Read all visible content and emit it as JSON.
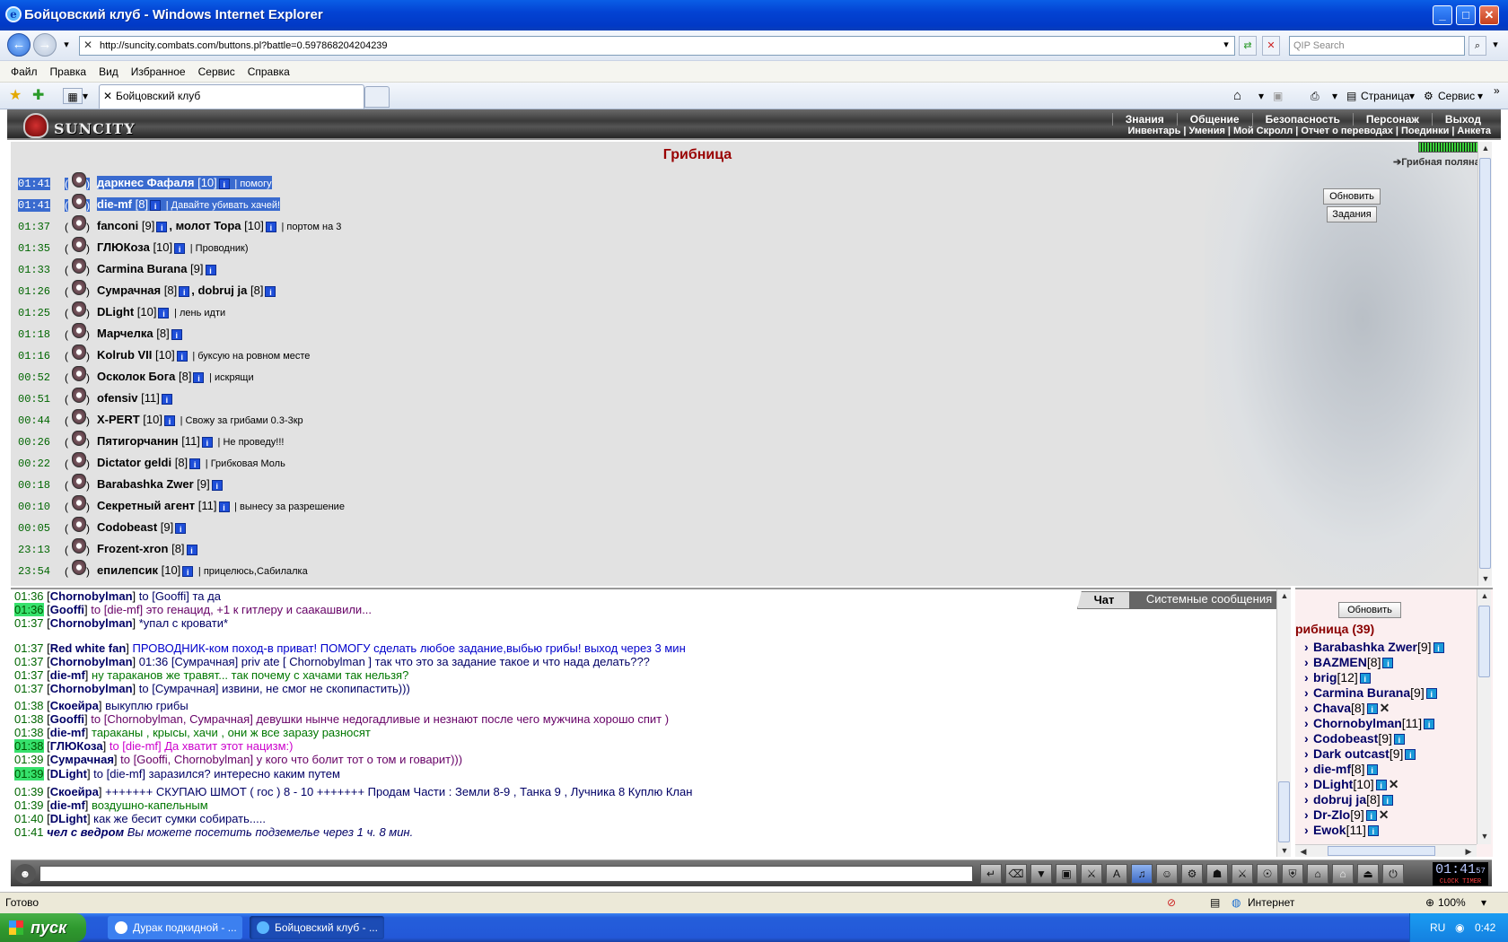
{
  "window": {
    "title": "Бойцовский клуб - Windows Internet Explorer"
  },
  "address": {
    "url": "http://suncity.combats.com/buttons.pl?battle=0.597868204204239",
    "search_placeholder": "QIP Search"
  },
  "menu": [
    "Файл",
    "Правка",
    "Вид",
    "Избранное",
    "Сервис",
    "Справка"
  ],
  "tab": {
    "title": "Бойцовский клуб"
  },
  "toolbar": {
    "page_label": "Страница",
    "service_label": "Сервис"
  },
  "game": {
    "logo": "SUNCITY",
    "top_menu": [
      "Знания",
      "Общение",
      "Безопасность",
      "Персонаж",
      "Выход"
    ],
    "sub_menu": [
      "Инвентарь",
      "Умения",
      "Мой Скролл",
      "Отчет о переводах",
      "Поединки",
      "Анкета"
    ],
    "room_title": "Грибница",
    "location_link": "Грибная поляна",
    "refresh_label": "Обновить",
    "tasks_label": "Задания",
    "players": [
      {
        "time": "01:41",
        "name": "даркнес Фафаля",
        "level": "[10]",
        "comment": "помогу",
        "selected": true
      },
      {
        "time": "01:41",
        "name": "die-mf",
        "level": "[8]",
        "comment": "Давайте убивать хачей!",
        "selected": true
      },
      {
        "time": "01:37",
        "name": "fanconi",
        "level": "[9]",
        "name2": "молот Тора",
        "level2": "[10]",
        "comment": "портом на 3"
      },
      {
        "time": "01:35",
        "name": "ГЛЮКоза",
        "level": "[10]",
        "comment": "Проводник)"
      },
      {
        "time": "01:33",
        "name": "Carmina Burana",
        "level": "[9]",
        "comment": ""
      },
      {
        "time": "01:26",
        "name": "Сумрачная",
        "level": "[8]",
        "name2": "dobruj ja",
        "level2": "[8]",
        "comment": ""
      },
      {
        "time": "01:25",
        "name": "DLight",
        "level": "[10]",
        "comment": "лень идти"
      },
      {
        "time": "01:18",
        "name": "Марчелка",
        "level": "[8]",
        "comment": ""
      },
      {
        "time": "01:16",
        "name": "Kolrub VII",
        "level": "[10]",
        "comment": "буксую на ровном месте"
      },
      {
        "time": "00:52",
        "name": "Осколок Бога",
        "level": "[8]",
        "comment": "искрящи"
      },
      {
        "time": "00:51",
        "name": "ofensiv",
        "level": "[11]",
        "comment": ""
      },
      {
        "time": "00:44",
        "name": "X-PERT",
        "level": "[10]",
        "comment": "Свожу за грибами 0.3-3кр"
      },
      {
        "time": "00:26",
        "name": "Пятигорчанин",
        "level": "[11]",
        "comment": "Не проведу!!!"
      },
      {
        "time": "00:22",
        "name": "Dictator geldi",
        "level": "[8]",
        "comment": "Грибковая Моль"
      },
      {
        "time": "00:18",
        "name": "Barabashka Zwer",
        "level": "[9]",
        "comment": ""
      },
      {
        "time": "00:10",
        "name": "Секретный агент",
        "level": "[11]",
        "comment": "вынесу за разрешение"
      },
      {
        "time": "00:05",
        "name": "Codobeast",
        "level": "[9]",
        "comment": ""
      },
      {
        "time": "23:13",
        "name": "Frozent-xron",
        "level": "[8]",
        "comment": ""
      },
      {
        "time": "23:54",
        "name": "епилепсик",
        "level": "[10]",
        "comment": "прицелюсь,Сабилалка"
      }
    ]
  },
  "chat": {
    "tab_chat": "Чат",
    "tab_system": "Системные сообщения",
    "lines": [
      {
        "time": "01:36",
        "nick": "Chornobylman",
        "text": " to [Gooffi] та да",
        "cls": "c-navy"
      },
      {
        "time": "01:36",
        "hl": true,
        "nick": "Gooffi",
        "text": " to [die-mf] это генацид, +1 к гитлеру и саакашвили...",
        "cls": "c-purple"
      },
      {
        "time": "01:37",
        "nick": "Chornobylman",
        "text": " *упал с кровати*",
        "cls": "c-navy"
      },
      {
        "time": "01:37",
        "nick": "Red white fan",
        "text": " ПРОВОДНИК-ком поход-в приват! ПОМОГУ сделать любое задание,выбью грибы!              выход через 3 мин",
        "cls": "c-blue"
      },
      {
        "time": "01:37",
        "nick": "Chornobylman",
        "text": " 01:36 [Сумрачная] priv ate [ Chornobylman ] так что это за задание такое и что нада делать???",
        "cls": "c-navy"
      },
      {
        "time": "01:37",
        "nick": "die-mf",
        "text": " ну тараканов же травят... так почему с хачами так нельзя?",
        "cls": "c-green"
      },
      {
        "time": "01:37",
        "nick": "Chornobylman",
        "text": " to [Сумрачная] извини, не смог не скопипастить)))",
        "cls": "c-navy"
      },
      {
        "time": "01:38",
        "nick": "Скоейра",
        "text": " выкуплю грибы",
        "cls": "c-navy"
      },
      {
        "time": "01:38",
        "nick": "Gooffi",
        "text": " to [Chornobylman, Сумрачная] девушки нынче недогадливые и незнают после чего мужчина хорошо спит )",
        "cls": "c-purple"
      },
      {
        "time": "01:38",
        "nick": "die-mf",
        "text": " тараканы , крысы, хачи , они ж все заразу разносят",
        "cls": "c-green"
      },
      {
        "time": "01:38",
        "hl": true,
        "nick": "ГЛЮКоза",
        "text": " to [die-mf] Да хватит этот нацизм:)",
        "cls": "c-magenta"
      },
      {
        "time": "01:39",
        "nick": "Сумрачная",
        "text": " to [Gooffi, Chornobylman] у кого что болит тот о том и говарит)))",
        "cls": "c-purple"
      },
      {
        "time": "01:39",
        "hl": true,
        "nick": "DLight",
        "text": " to [die-mf] заразился?   интересно каким путем",
        "cls": "c-navy"
      },
      {
        "time": "01:39",
        "nick": "Скоейра",
        "text": "          +++++++ СКУПАЮ ШМОТ ( гос ) 8 - 10 +++++++          Продам Части : Земли 8-9 , Танка 9 , Лучника 8          Куплю Клан",
        "cls": "c-navy"
      },
      {
        "time": "01:39",
        "nick": "die-mf",
        "text": " воздушно-капельным",
        "cls": "c-green"
      },
      {
        "time": "01:40",
        "nick": "DLight",
        "text": " как же бесит сумки собирать.....",
        "cls": "c-navy"
      },
      {
        "time": "01:41",
        "nick": "чел с ведром",
        "text": " Вы можете посетить подземелье через 1 ч. 8 мин.",
        "cls": "c-navy",
        "system": true
      }
    ]
  },
  "online": {
    "refresh_label": "Обновить",
    "title": "рибница (39)",
    "users": [
      {
        "name": "Barabashka Zwer",
        "level": "[9]"
      },
      {
        "name": "BAZMEN",
        "level": "[8]"
      },
      {
        "name": "brig",
        "level": "[12]"
      },
      {
        "name": "Carmina Burana",
        "level": "[9]"
      },
      {
        "name": "Chava",
        "level": "[8]",
        "x": true
      },
      {
        "name": "Chornobylman",
        "level": "[11]"
      },
      {
        "name": "Codobeast",
        "level": "[9]"
      },
      {
        "name": "Dark outcast",
        "level": "[9]"
      },
      {
        "name": "die-mf",
        "level": "[8]"
      },
      {
        "name": "DLight",
        "level": "[10]",
        "x": true
      },
      {
        "name": "dobruj ja",
        "level": "[8]"
      },
      {
        "name": "Dr-Zlo",
        "level": "[9]",
        "x": true
      },
      {
        "name": "Ewok",
        "level": "[11]"
      }
    ]
  },
  "clock": {
    "time": "01:41",
    "sec": "57",
    "label": "CLOCK TIMER"
  },
  "status": {
    "ready": "Готово",
    "zone": "Интернет",
    "zoom": "100%"
  },
  "taskbar": {
    "start": "пуск",
    "items": [
      "Дурак подкидной - ...",
      "Бойцовский клуб - ..."
    ],
    "lang": "RU",
    "time": "0:42"
  }
}
